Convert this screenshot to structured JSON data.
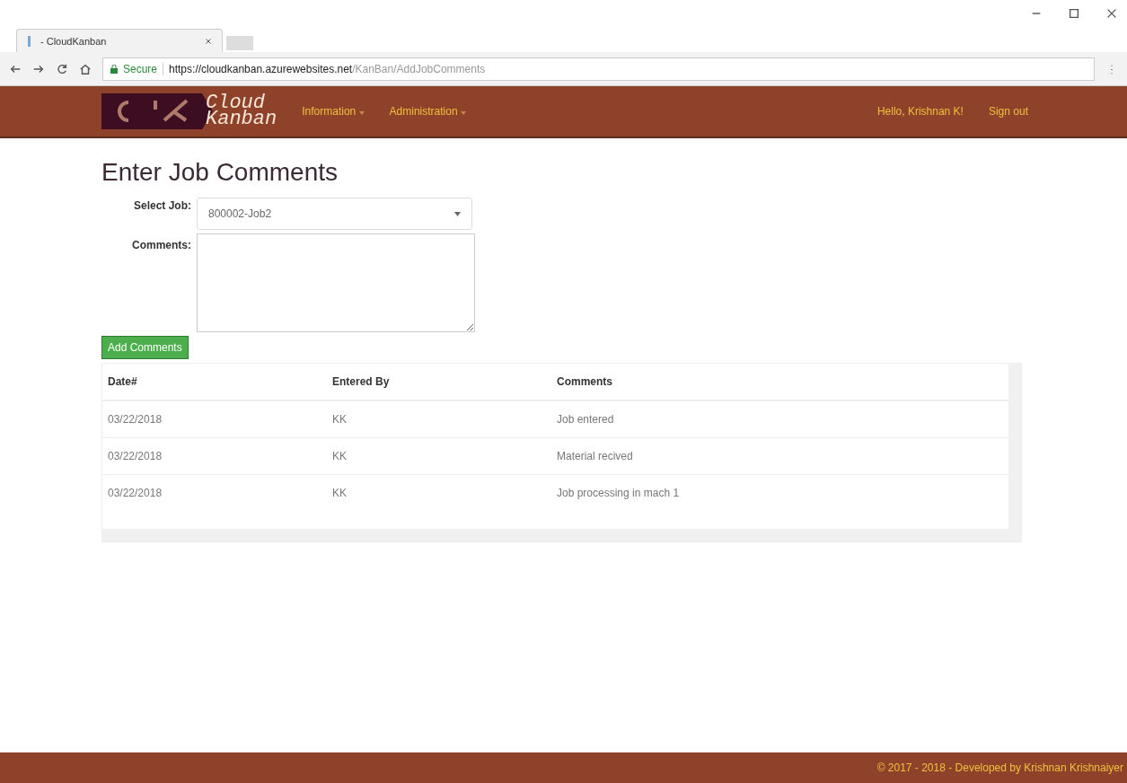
{
  "browser": {
    "tab_title": "- CloudKanban",
    "secure_label": "Secure",
    "url_host": "https://cloudkanban.azurewebsites.net",
    "url_path": "/KanBan/AddJobComments"
  },
  "navbar": {
    "logo_line1": "Cloud",
    "logo_line2": "Kanban",
    "menus": [
      "Information",
      "Administration"
    ],
    "greeting": "Hello, Krishnan K!",
    "sign_out": "Sign out"
  },
  "page_title": "Enter Job Comments",
  "form": {
    "select_label": "Select Job:",
    "select_value": "800002-Job2",
    "comments_label": "Comments:",
    "submit": "Add Comments"
  },
  "table": {
    "columns": [
      "Date#",
      "Entered By",
      "Comments"
    ],
    "rows": [
      {
        "cells": [
          "03/22/2018",
          "KK",
          "Job entered"
        ]
      },
      {
        "cells": [
          "03/22/2018",
          "KK",
          "Material recived"
        ]
      },
      {
        "cells": [
          "03/22/2018",
          "KK",
          "Job processing in mach 1"
        ]
      }
    ]
  },
  "footer": "© 2017 - 2018 - Developed by Krishnan Krishnaiyer"
}
